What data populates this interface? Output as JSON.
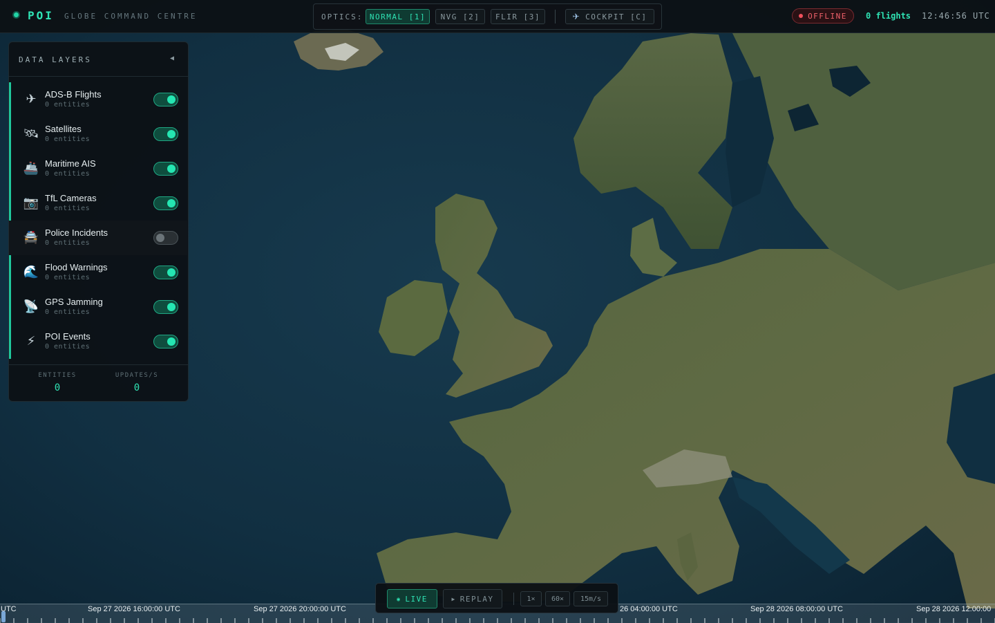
{
  "header": {
    "brand": "POI",
    "subtitle": "GLOBE COMMAND CENTRE",
    "optics_label": "OPTICS:",
    "optics": [
      {
        "label": "NORMAL [1]",
        "active": true
      },
      {
        "label": "NVG [2]",
        "active": false
      },
      {
        "label": "FLIR [3]",
        "active": false
      }
    ],
    "cockpit_label": "COCKPIT [C]",
    "status": "OFFLINE",
    "flights": "0 flights",
    "clock": "12:46:56 UTC"
  },
  "panel": {
    "title": "DATA LAYERS",
    "collapse": "◀",
    "layers": [
      {
        "name": "ADS-B Flights",
        "count": "0 entities",
        "icon": "airplane-icon",
        "glyph": "✈",
        "enabled": true
      },
      {
        "name": "Satellites",
        "count": "0 entities",
        "icon": "satellite-icon",
        "glyph": "🛰",
        "enabled": true
      },
      {
        "name": "Maritime AIS",
        "count": "0 entities",
        "icon": "ship-icon",
        "glyph": "🚢",
        "enabled": true
      },
      {
        "name": "TfL Cameras",
        "count": "0 entities",
        "icon": "camera-icon",
        "glyph": "📷",
        "enabled": true
      },
      {
        "name": "Police Incidents",
        "count": "0 entities",
        "icon": "police-car-icon",
        "glyph": "🚔",
        "enabled": false
      },
      {
        "name": "Flood Warnings",
        "count": "0 entities",
        "icon": "wave-icon",
        "glyph": "🌊",
        "enabled": true
      },
      {
        "name": "GPS Jamming",
        "count": "0 entities",
        "icon": "satellite-dish-icon",
        "glyph": "📡",
        "enabled": true
      },
      {
        "name": "POI Events",
        "count": "0 entities",
        "icon": "lightning-icon",
        "glyph": "⚡",
        "enabled": true
      }
    ],
    "stats": [
      {
        "label": "ENTITIES",
        "value": "0"
      },
      {
        "label": "UPDATES/S",
        "value": "0"
      }
    ]
  },
  "playback": {
    "live": "LIVE",
    "replay": "REPLAY",
    "speeds": [
      "1×",
      "60×",
      "15m/s"
    ]
  },
  "timeline": {
    "labels": [
      "UTC",
      "Sep 27 2026 16:00:00 UTC",
      "Sep 27 2026 20:00:00 UTC",
      "26 04:00:00 UTC",
      "Sep 28 2026 08:00:00 UTC",
      "Sep 28 2026 12:00:00"
    ]
  },
  "colors": {
    "accent": "#2fe3b4",
    "offline": "#f0616b",
    "ocean": "#0f2a3a",
    "land": "#4b5a3a"
  }
}
